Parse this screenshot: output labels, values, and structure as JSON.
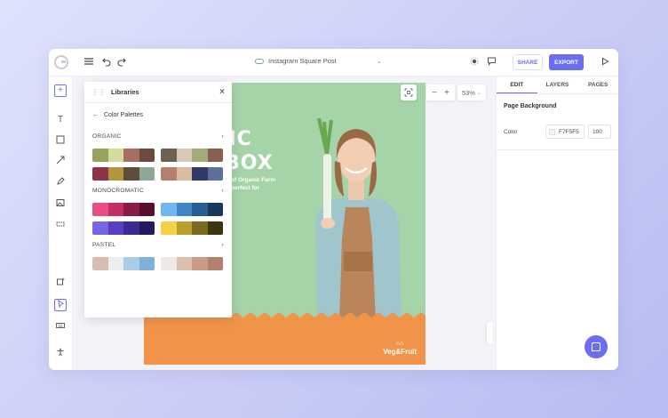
{
  "topbar": {
    "doc_title": "Instagram Square Post",
    "share_label": "SHARE",
    "export_label": "EXPORT"
  },
  "canvas": {
    "zoom_label": "53%",
    "headline_line1": "ANIC",
    "headline_line2": "BOX",
    "subline_line1": "of Organic Farm",
    "subline_line2": "perfect for",
    "brand_name": "Veg&Fruit",
    "colors": {
      "green": "#a5d4a8",
      "orange": "#f19449"
    }
  },
  "libraries": {
    "title": "Libraries",
    "subtitle": "Color Palettes",
    "sections": [
      {
        "name": "ORGANIC",
        "palettes": [
          [
            "#9aa35e",
            "#d4dc9c",
            "#a57062",
            "#6e4b40"
          ],
          [
            "#6c6253",
            "#d8c8b5",
            "#a4ab7b",
            "#8a5e50"
          ],
          [
            "#8b3546",
            "#b2963c",
            "#5e4d3a",
            "#8fa896"
          ],
          [
            "#b67f6d",
            "#d8bda4",
            "#313c66",
            "#5e6f9a"
          ]
        ]
      },
      {
        "name": "MONOCROMATIC",
        "palettes": [
          [
            "#ec4d7f",
            "#c42e63",
            "#8a1a46",
            "#5a0e2e"
          ],
          [
            "#6eb7f0",
            "#3f86c8",
            "#265f94",
            "#163a5e"
          ],
          [
            "#7368e2",
            "#5a3fc4",
            "#3c2a92",
            "#241a5e"
          ],
          [
            "#f5d146",
            "#bb9f2d",
            "#7a6a1f",
            "#3d3510"
          ]
        ]
      },
      {
        "name": "PASTEL",
        "palettes": [
          [
            "#d8bcb0",
            "#eeeeee",
            "#a9cde8",
            "#7fb1d8"
          ],
          [
            "#eee9e4",
            "#dbbfb0",
            "#c99a86",
            "#b1816d"
          ]
        ]
      }
    ]
  },
  "rightpanel": {
    "tabs": [
      "EDIT",
      "LAYERS",
      "PAGES"
    ],
    "section_title": "Page Background",
    "color_label": "Color",
    "color_value": "F7F5F5",
    "opacity_value": "100"
  }
}
